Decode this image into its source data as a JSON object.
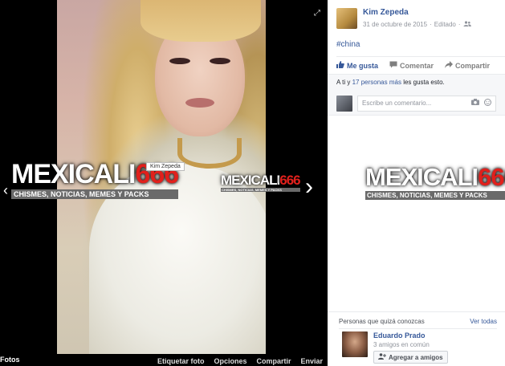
{
  "viewer": {
    "tag_label": "Kim Zepeda",
    "album_label": "Fotos",
    "actions": [
      "Etiquetar foto",
      "Opciones",
      "Compartir",
      "Enviar"
    ]
  },
  "watermark": {
    "title_text": "MEXICALI",
    "title_number": "666",
    "subtitle": "CHISMES, NOTICIAS, MEMES Y PACKS"
  },
  "post": {
    "author": "Kim Zepeda",
    "date": "31 de octubre de 2015",
    "edited": "Editado",
    "hashtag": "#china",
    "like_label": "Me gusta",
    "comment_label": "Comentar",
    "share_label": "Compartir",
    "likes_prefix": "A ti y",
    "likes_link": "17 personas más",
    "likes_suffix": "les gusta esto.",
    "comment_placeholder": "Escribe un comentario..."
  },
  "pymk": {
    "title": "Personas que quizá conozcas",
    "see_all": "Ver todas",
    "person_name": "Eduardo Prado",
    "person_mutual": "3 amigos en común",
    "add_label": "Agregar a amigos"
  },
  "colors": {
    "link": "#365899",
    "brand_red": "#e0201c"
  }
}
